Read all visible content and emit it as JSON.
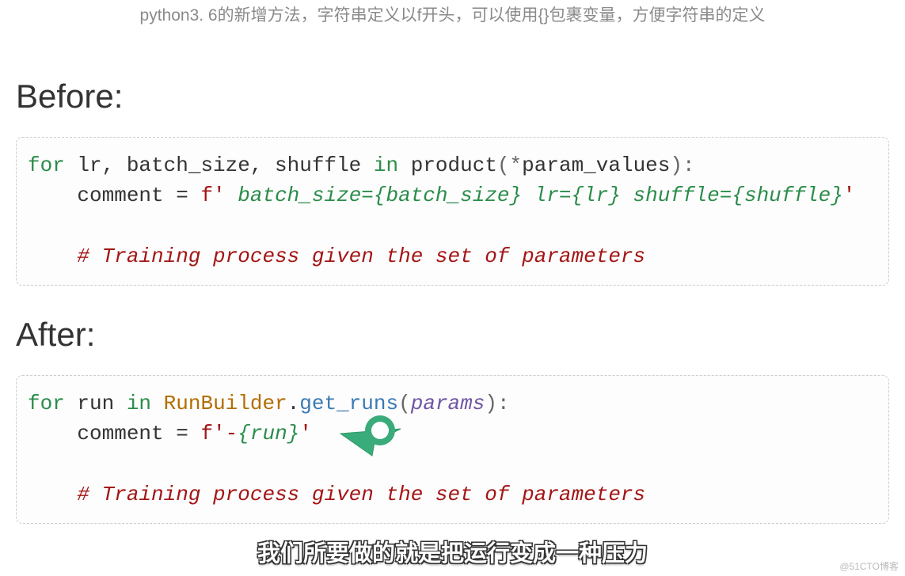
{
  "top_caption": "python3. 6的新增方法，字符串定义以f开头，可以使用{}包裹变量，方便字符串的定义",
  "heading_before": "Before:",
  "heading_after": "After:",
  "code_before": {
    "kw_for": "for",
    "vars": " lr, batch_size, shuffle ",
    "kw_in": "in",
    "fn": " product",
    "args_open": "(*",
    "args": "param_values",
    "args_close": "):",
    "indent": "    ",
    "assign": "comment = ",
    "fstr_open": "f' ",
    "fstr_body1": "batch_size={batch_size} lr={lr} shuffle={shuffle}",
    "fstr_close": "'",
    "comment": "# Training process given the set of parameters"
  },
  "code_after": {
    "kw_for": "for",
    "var": " run ",
    "kw_in": "in",
    "space": " ",
    "cls": "RunBuilder",
    "dot": ".",
    "method": "get_runs",
    "args_open": "(",
    "args": "params",
    "args_close": "):",
    "indent": "    ",
    "assign": "comment = ",
    "fstr_open": "f'-",
    "fstr_var": "{run}",
    "fstr_close": "'",
    "comment": "# Training process given the set of parameters"
  },
  "bottom_caption": "我们所要做的就是把运行变成一种压力",
  "watermark": "@51CTO博客"
}
